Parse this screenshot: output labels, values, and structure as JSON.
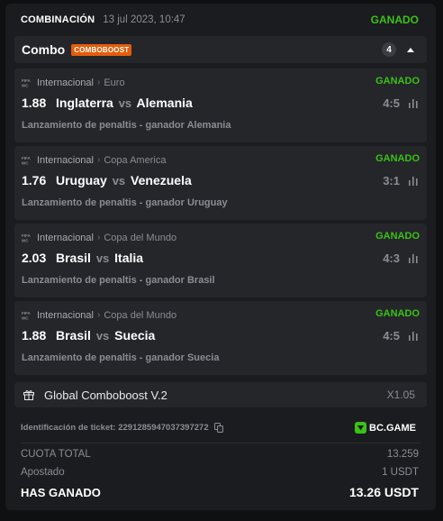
{
  "header": {
    "title": "COMBINACIÓN",
    "datetime": "13 jul 2023, 10:47",
    "status": "GANADO"
  },
  "combo": {
    "name": "Combo",
    "badge": "COMBOBOOST",
    "count": "4"
  },
  "bets": [
    {
      "category": "Internacional",
      "tournament": "Euro",
      "status": "GANADO",
      "odds": "1.88",
      "home": "Inglaterra",
      "vs": "vs",
      "away": "Alemania",
      "score": "4:5",
      "market": "Lanzamiento de penaltis - ganador Alemania"
    },
    {
      "category": "Internacional",
      "tournament": "Copa America",
      "status": "GANADO",
      "odds": "1.76",
      "home": "Uruguay",
      "vs": "vs",
      "away": "Venezuela",
      "score": "3:1",
      "market": "Lanzamiento de penaltis - ganador Uruguay"
    },
    {
      "category": "Internacional",
      "tournament": "Copa del Mundo",
      "status": "GANADO",
      "odds": "2.03",
      "home": "Brasil",
      "vs": "vs",
      "away": "Italia",
      "score": "4:3",
      "market": "Lanzamiento de penaltis - ganador Brasil"
    },
    {
      "category": "Internacional",
      "tournament": "Copa del Mundo",
      "status": "GANADO",
      "odds": "1.88",
      "home": "Brasil",
      "vs": "vs",
      "away": "Suecia",
      "score": "4:5",
      "market": "Lanzamiento de penaltis - ganador Suecia"
    }
  ],
  "global_boost": {
    "label": "Global Comboboost V.2",
    "multiplier": "X1.05"
  },
  "ticket": {
    "label": "Identificación de ticket: 2291285947037397272",
    "brand": "BC.GAME"
  },
  "summary": {
    "odds_label": "CUOTA TOTAL",
    "odds_value": "13.259",
    "stake_label": "Apostado",
    "stake_value": "1 USDT",
    "won_label": "HAS GANADO",
    "won_value": "13.26 USDT"
  },
  "colors": {
    "win_green": "#3bc117",
    "boost_orange": "#e35d0c",
    "card_bg": "#1b1c1f",
    "panel_bg": "#24262a"
  },
  "icons": [
    "fifa-icon",
    "chevron-right-icon",
    "stats-icon",
    "gift-icon",
    "copy-icon",
    "bcgame-logo-icon",
    "caret-up-icon"
  ]
}
